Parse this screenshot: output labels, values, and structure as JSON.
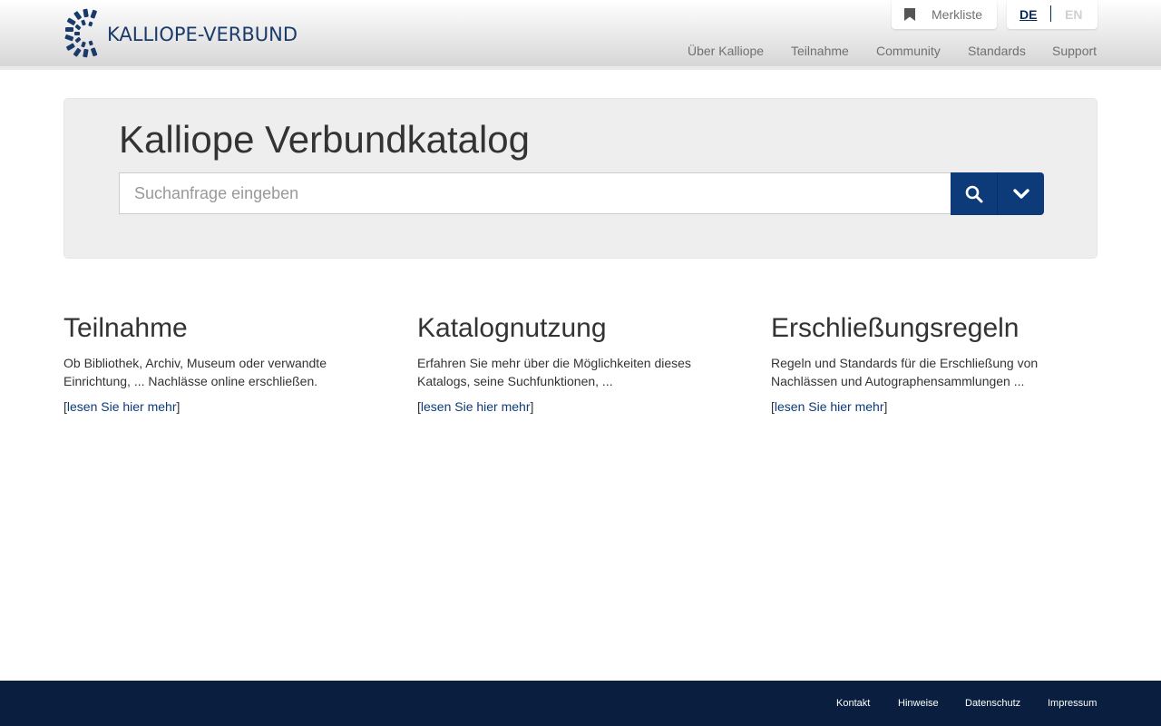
{
  "brand": {
    "name": "KALLIOPE-VERBUND",
    "accent": "#0d3a78",
    "footer_bg": "#0a1f3f"
  },
  "header": {
    "merkliste": {
      "icon": "bookmark-icon",
      "label": "Merkliste"
    },
    "lang": {
      "de": "DE",
      "en": "EN",
      "active": "DE"
    },
    "nav": [
      "Über Kalliope",
      "Teilnahme",
      "Community",
      "Standards",
      "Support"
    ]
  },
  "search": {
    "title": "Kalliope Verbundkatalog",
    "placeholder": "Suchanfrage eingeben",
    "value": "",
    "search_icon": "search-icon",
    "dropdown_icon": "chevron-down-icon"
  },
  "teasers": [
    {
      "title": "Teilnahme",
      "text": "Ob Bibliothek, Archiv, Museum oder verwandte Einrichtung, ... Nachlässe online erschließen.",
      "link": "lesen Sie hier mehr"
    },
    {
      "title": "Katalognutzung",
      "text": "Erfahren Sie mehr über die Möglichkeiten dieses Katalogs, seine Suchfunktionen, ...",
      "link": "lesen Sie hier mehr"
    },
    {
      "title": "Erschließungsregeln",
      "text": "Regeln und Standards für die Erschließung von Nachlässen und Autographensammlungen ...",
      "link": "lesen Sie hier mehr"
    }
  ],
  "footer": {
    "links": [
      "Kontakt",
      "Hinweise",
      "Datenschutz",
      "Impressum"
    ]
  }
}
